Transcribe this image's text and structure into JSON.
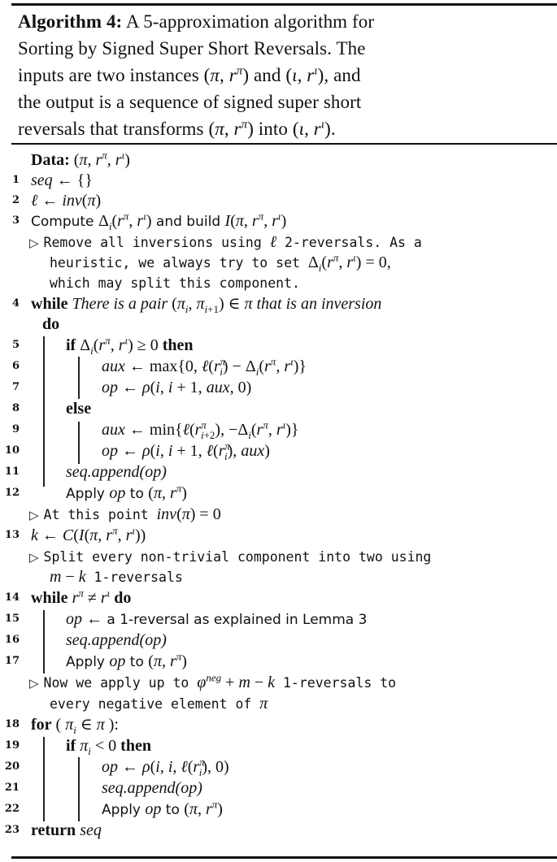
{
  "caption": {
    "label": "Algorithm 4:",
    "lines": [
      " A 5-approximation algorithm for",
      "Sorting by Signed Super Short Reversals. The",
      "inputs are two instances (π, r^π) and (ι, r^ι), and",
      "the output is a sequence of signed super short",
      "reversals that transforms (π, r^π) into (ι, r^ι)."
    ]
  },
  "data_line": {
    "label": "Data:",
    "value": " (π, rπ, rι)"
  },
  "lines": [
    {
      "n": "1",
      "text": "seq ← {}"
    },
    {
      "n": "2",
      "text": "ℓ ← inv(π)"
    },
    {
      "n": "3",
      "text": "Compute Δi(rπ, rι) and build I(π, rπ, rι)"
    },
    {
      "n": "",
      "text": "Remove all inversions using ℓ 2-reversals. As a"
    },
    {
      "n": "",
      "text": "heuristic, we always try to set Δi(rπ, rι) = 0,"
    },
    {
      "n": "",
      "text": "which may split this component."
    },
    {
      "n": "4",
      "text": "while There is a pair (πi, πi+1) ∈ π that is an inversion"
    },
    {
      "n": "",
      "text": "do"
    },
    {
      "n": "5",
      "text": "if Δi(rπ, rι) ≥ 0 then"
    },
    {
      "n": "6",
      "text": "aux ← max{0, ℓ(riπ) − Δi(rπ, rι)}"
    },
    {
      "n": "7",
      "text": "op ← ρ(i, i + 1, aux, 0)"
    },
    {
      "n": "8",
      "text": "else"
    },
    {
      "n": "9",
      "text": "aux ← min{ℓ(ri+2π), −Δi(rπ, rι)}"
    },
    {
      "n": "10",
      "text": "op ← ρ(i, i + 1, ℓ(riπ), aux)"
    },
    {
      "n": "11",
      "text": "seq.append(op)"
    },
    {
      "n": "12",
      "text": "Apply op to (π, rπ)"
    },
    {
      "n": "",
      "text": "At this point inv(π) = 0"
    },
    {
      "n": "13",
      "text": "k ← C(I(π, rπ, rι))"
    },
    {
      "n": "",
      "text": "Split every non-trivial component into two using"
    },
    {
      "n": "",
      "text": "m − k 1-reversals"
    },
    {
      "n": "14",
      "text": "while rπ ≠ rι do"
    },
    {
      "n": "15",
      "text": "op ← a 1-reversal as explained in Lemma 3"
    },
    {
      "n": "16",
      "text": "seq.append(op)"
    },
    {
      "n": "17",
      "text": "Apply op to (π, rπ)"
    },
    {
      "n": "",
      "text": "Now we apply up to φneg + m − k 1-reversals to"
    },
    {
      "n": "",
      "text": "every negative element of π"
    },
    {
      "n": "18",
      "text": "for ( πi ∈ π ):"
    },
    {
      "n": "19",
      "text": "if πi < 0 then"
    },
    {
      "n": "20",
      "text": "op ← ρ(i, i, ℓ(riπ), 0)"
    },
    {
      "n": "21",
      "text": "seq.append(op)"
    },
    {
      "n": "22",
      "text": "Apply op to (π, rπ)"
    },
    {
      "n": "23",
      "text": "return seq"
    }
  ],
  "parts": {
    "data": "Data:",
    "while": "while",
    "do": "do",
    "if": "if",
    "then": "then",
    "else": "else",
    "for": "for",
    "return": "return",
    "l1_seq": "seq",
    "l1_rest": " ← {}",
    "l2_ell": "ℓ",
    "l2_arrow": " ← ",
    "l2_inv": "inv",
    "l2_rest": "(π)",
    "l3_compute": "Compute ",
    "l3_delta": "Δ",
    "l3_i": "i",
    "l3_args": "(r",
    "pi": "π",
    "iota": "ι",
    "l3_and": " and build ",
    "l3_I": "I",
    "c1a": "Remove all inversions using ",
    "c1b": " 2-reversals. As a",
    "c2a": "heuristic, we always try to set ",
    "c3": "which may split this component.",
    "l4_text": "There is a pair",
    "l4_tail": "that is an inversion",
    "apply": "Apply ",
    "op": "op",
    "to": " to ",
    "seq_append": "seq.append(op)",
    "c4a": "At this point ",
    "c5": "Split every non-trivial component into two using",
    "c6b": " 1-reversals",
    "l15_rest": " a 1-reversal as explained in Lemma 3",
    "c7a": "Now we apply up to ",
    "c7b": " 1-reversals to",
    "c8": "every negative element of ",
    "aux": "aux",
    "seq": "seq"
  }
}
